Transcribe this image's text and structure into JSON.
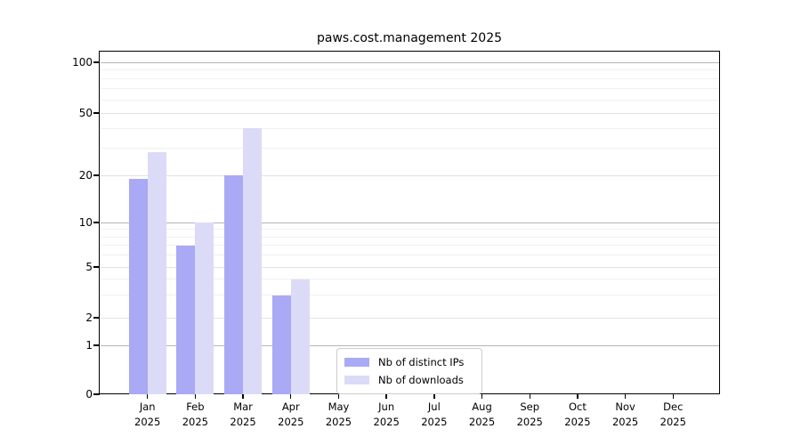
{
  "chart_data": {
    "type": "bar",
    "title": "paws.cost.management 2025",
    "scale_y": "symlog",
    "grid": true,
    "legend_position": "lower center",
    "categories": [
      "Jan 2025",
      "Feb 2025",
      "Mar 2025",
      "Apr 2025",
      "May 2025",
      "Jun 2025",
      "Jul 2025",
      "Aug 2025",
      "Sep 2025",
      "Oct 2025",
      "Nov 2025",
      "Dec 2025"
    ],
    "series": [
      {
        "name": "Nb of distinct IPs",
        "color": "#a9a9f6",
        "values": [
          19,
          7,
          20,
          3,
          0,
          0,
          0,
          0,
          0,
          0,
          0,
          0
        ]
      },
      {
        "name": "Nb of downloads",
        "color": "#dbdbf8",
        "values": [
          28,
          10,
          40,
          4,
          0,
          0,
          0,
          0,
          0,
          0,
          0,
          0
        ]
      }
    ],
    "y_axis": {
      "tick_labels": [
        100,
        50,
        20,
        10,
        5,
        2,
        1,
        0
      ],
      "decade_gridlines": [
        1,
        10,
        100
      ],
      "minor_gridlines": [
        3,
        4,
        6,
        7,
        8,
        9,
        30,
        40,
        60,
        70,
        80,
        90
      ],
      "ylim": [
        0,
        110
      ]
    }
  }
}
